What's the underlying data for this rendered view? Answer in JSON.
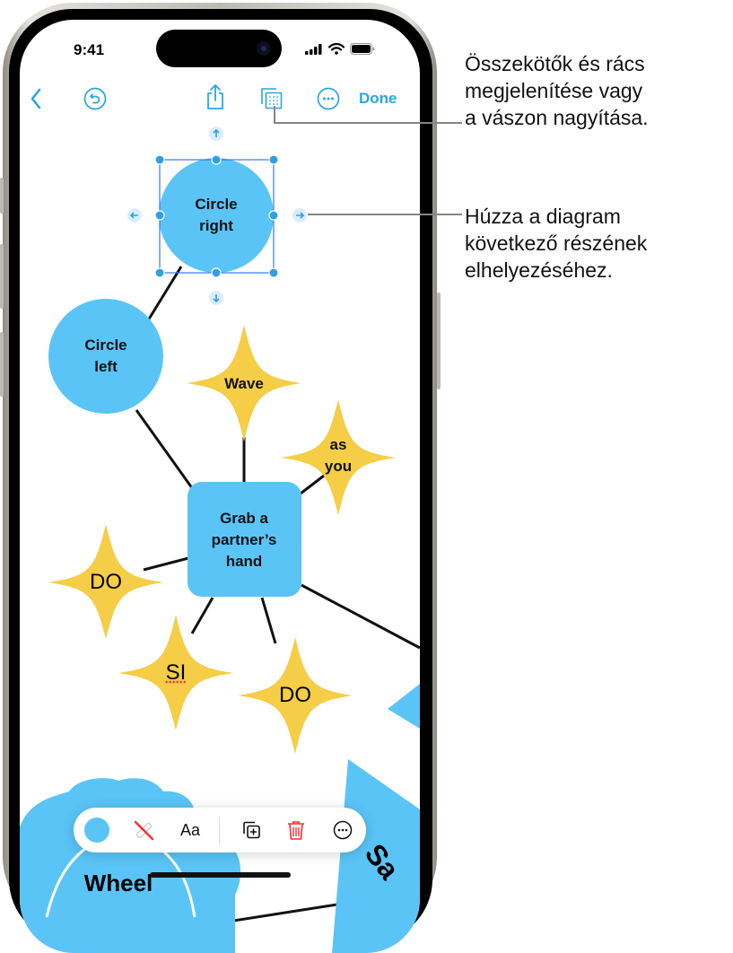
{
  "status_bar": {
    "time": "9:41"
  },
  "nav": {
    "back_icon": "chevron-left-icon",
    "undo_icon": "undo-icon",
    "share_icon": "share-icon",
    "view_options_icon": "grid-view-icon",
    "more_icon": "ellipsis-circle-icon",
    "done_label": "Done"
  },
  "diagram": {
    "nodes": [
      {
        "id": "circle-right",
        "shape": "circle",
        "lines": [
          "Circle",
          "right"
        ],
        "color": "#5ac4f6",
        "selected": true
      },
      {
        "id": "circle-left",
        "shape": "circle",
        "lines": [
          "Circle",
          "left"
        ],
        "color": "#5ac4f6"
      },
      {
        "id": "wave",
        "shape": "star",
        "lines": [
          "Wave"
        ],
        "color": "#f5cd46"
      },
      {
        "id": "as-you",
        "shape": "star",
        "lines": [
          "as",
          "you"
        ],
        "color": "#f5cd46"
      },
      {
        "id": "grab",
        "shape": "rounded-square",
        "lines": [
          "Grab a",
          "partner’s",
          "hand"
        ],
        "color": "#5ac4f6"
      },
      {
        "id": "do-left",
        "shape": "star",
        "lines": [
          "DO"
        ],
        "color": "#f5cd46"
      },
      {
        "id": "si",
        "shape": "star",
        "lines": [
          "SI"
        ],
        "color": "#f5cd46"
      },
      {
        "id": "do-bottom",
        "shape": "star",
        "lines": [
          "DO"
        ],
        "color": "#f5cd46"
      },
      {
        "id": "wheel",
        "shape": "cloud",
        "lines": [
          "Wheel"
        ],
        "color": "#5ac4f6"
      },
      {
        "id": "say",
        "shape": "polygon",
        "lines": [
          "Say"
        ],
        "color": "#5ac4f6"
      }
    ],
    "label_circle_right_1": "Circle",
    "label_circle_right_2": "right",
    "label_circle_left_1": "Circle",
    "label_circle_left_2": "left",
    "label_wave": "Wave",
    "label_as": "as",
    "label_you": "you",
    "label_grab_1": "Grab a",
    "label_grab_2": "partner’s",
    "label_grab_3": "hand",
    "label_do_left": "DO",
    "label_si": "SI",
    "label_do_bottom": "DO",
    "label_wheel": "Wheel",
    "label_say": "Sa"
  },
  "toolbar": {
    "fill_color": "#5ac4f6",
    "stroke_icon": "no-stroke-icon",
    "text_style_label": "Aa",
    "duplicate_icon": "duplicate-icon",
    "delete_icon": "trash-icon",
    "more_icon": "ellipsis-circle-icon"
  },
  "callouts": [
    {
      "text_lines": [
        "Összekötők és rács",
        "megjelenítése vagy",
        "a vászon nagyítása."
      ]
    },
    {
      "text_lines": [
        "Húzza a diagram",
        "következő részének",
        "elhelyezéséhez."
      ]
    }
  ],
  "colors": {
    "accent": "#2aa6e0",
    "shape_blue": "#5ac4f6",
    "shape_yellow": "#f5cd46",
    "selection": "#3478f6",
    "delete_red": "#ff3b30"
  }
}
